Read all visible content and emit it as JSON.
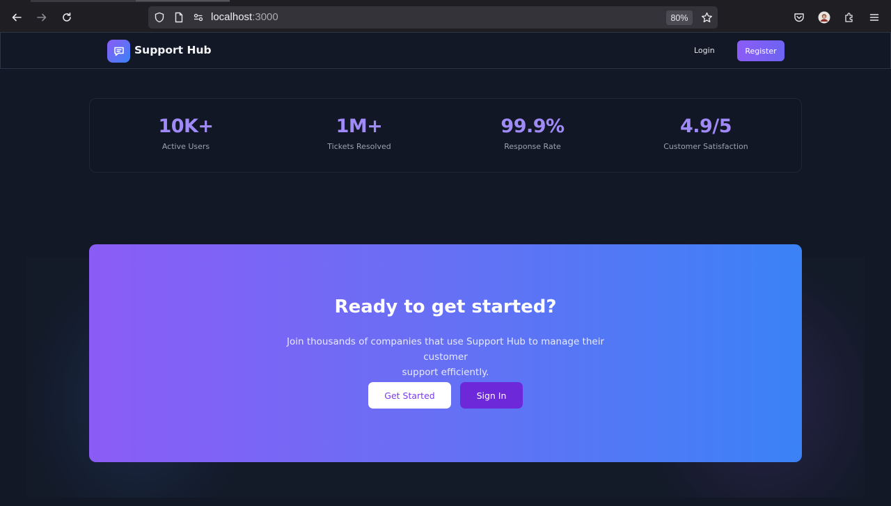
{
  "browser": {
    "url_host": "localhost",
    "url_port": ":3000",
    "zoom": "80%",
    "icons": [
      "back-icon",
      "forward-icon",
      "reload-icon",
      "shield-icon",
      "page-icon",
      "connection-icon",
      "bookmark-star-icon",
      "pocket-icon",
      "account-avatar-icon",
      "extensions-icon",
      "menu-icon"
    ]
  },
  "nav": {
    "brand": "Support Hub",
    "login": "Login",
    "register": "Register"
  },
  "stats": [
    {
      "value": "10K+",
      "label": "Active Users"
    },
    {
      "value": "1M+",
      "label": "Tickets Resolved"
    },
    {
      "value": "99.9%",
      "label": "Response Rate"
    },
    {
      "value": "4.9/5",
      "label": "Customer Satisfaction"
    }
  ],
  "cta": {
    "title": "Ready to get started?",
    "subtitle_line1": "Join thousands of companies that use Support Hub to manage their customer",
    "subtitle_line2": "support efficiently.",
    "primary": "Get Started",
    "secondary": "Sign In"
  },
  "colors": {
    "accent": "#8b5cf6",
    "blue": "#3b82f6",
    "background": "#121826"
  }
}
